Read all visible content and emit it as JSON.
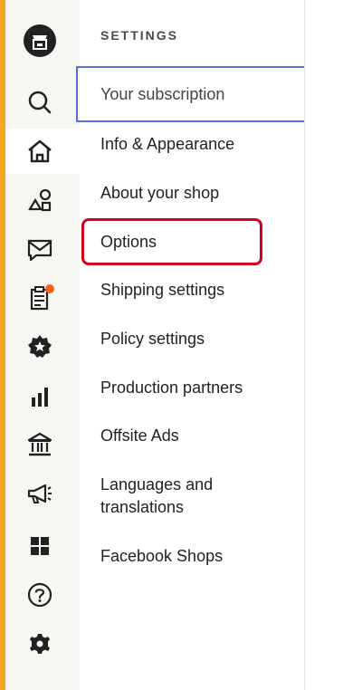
{
  "sidebar": {
    "items": [
      {
        "icon": "shop-logo-icon"
      },
      {
        "icon": "search-icon"
      },
      {
        "icon": "home-icon",
        "active": true
      },
      {
        "icon": "listings-icon"
      },
      {
        "icon": "messages-icon"
      },
      {
        "icon": "orders-icon",
        "badge_color": "#F1641E"
      },
      {
        "icon": "star-seller-icon"
      },
      {
        "icon": "stats-icon"
      },
      {
        "icon": "finances-icon"
      },
      {
        "icon": "marketing-icon"
      },
      {
        "icon": "integrations-icon"
      },
      {
        "icon": "help-icon"
      },
      {
        "icon": "settings-icon"
      }
    ]
  },
  "settings": {
    "heading": "SETTINGS",
    "items": [
      {
        "label": "Your subscription"
      },
      {
        "label": "Info & Appearance"
      },
      {
        "label": "About your shop"
      },
      {
        "label": "Options"
      },
      {
        "label": "Shipping settings"
      },
      {
        "label": "Policy settings"
      },
      {
        "label": "Production partners"
      },
      {
        "label": "Offsite Ads"
      },
      {
        "label": "Languages and translations"
      },
      {
        "label": "Facebook Shops"
      }
    ]
  },
  "colors": {
    "accent_bar": "#F5A623",
    "selection_outline": "#5B6FD6",
    "highlight_box": "#D0021B",
    "notification_dot": "#F1641E"
  }
}
